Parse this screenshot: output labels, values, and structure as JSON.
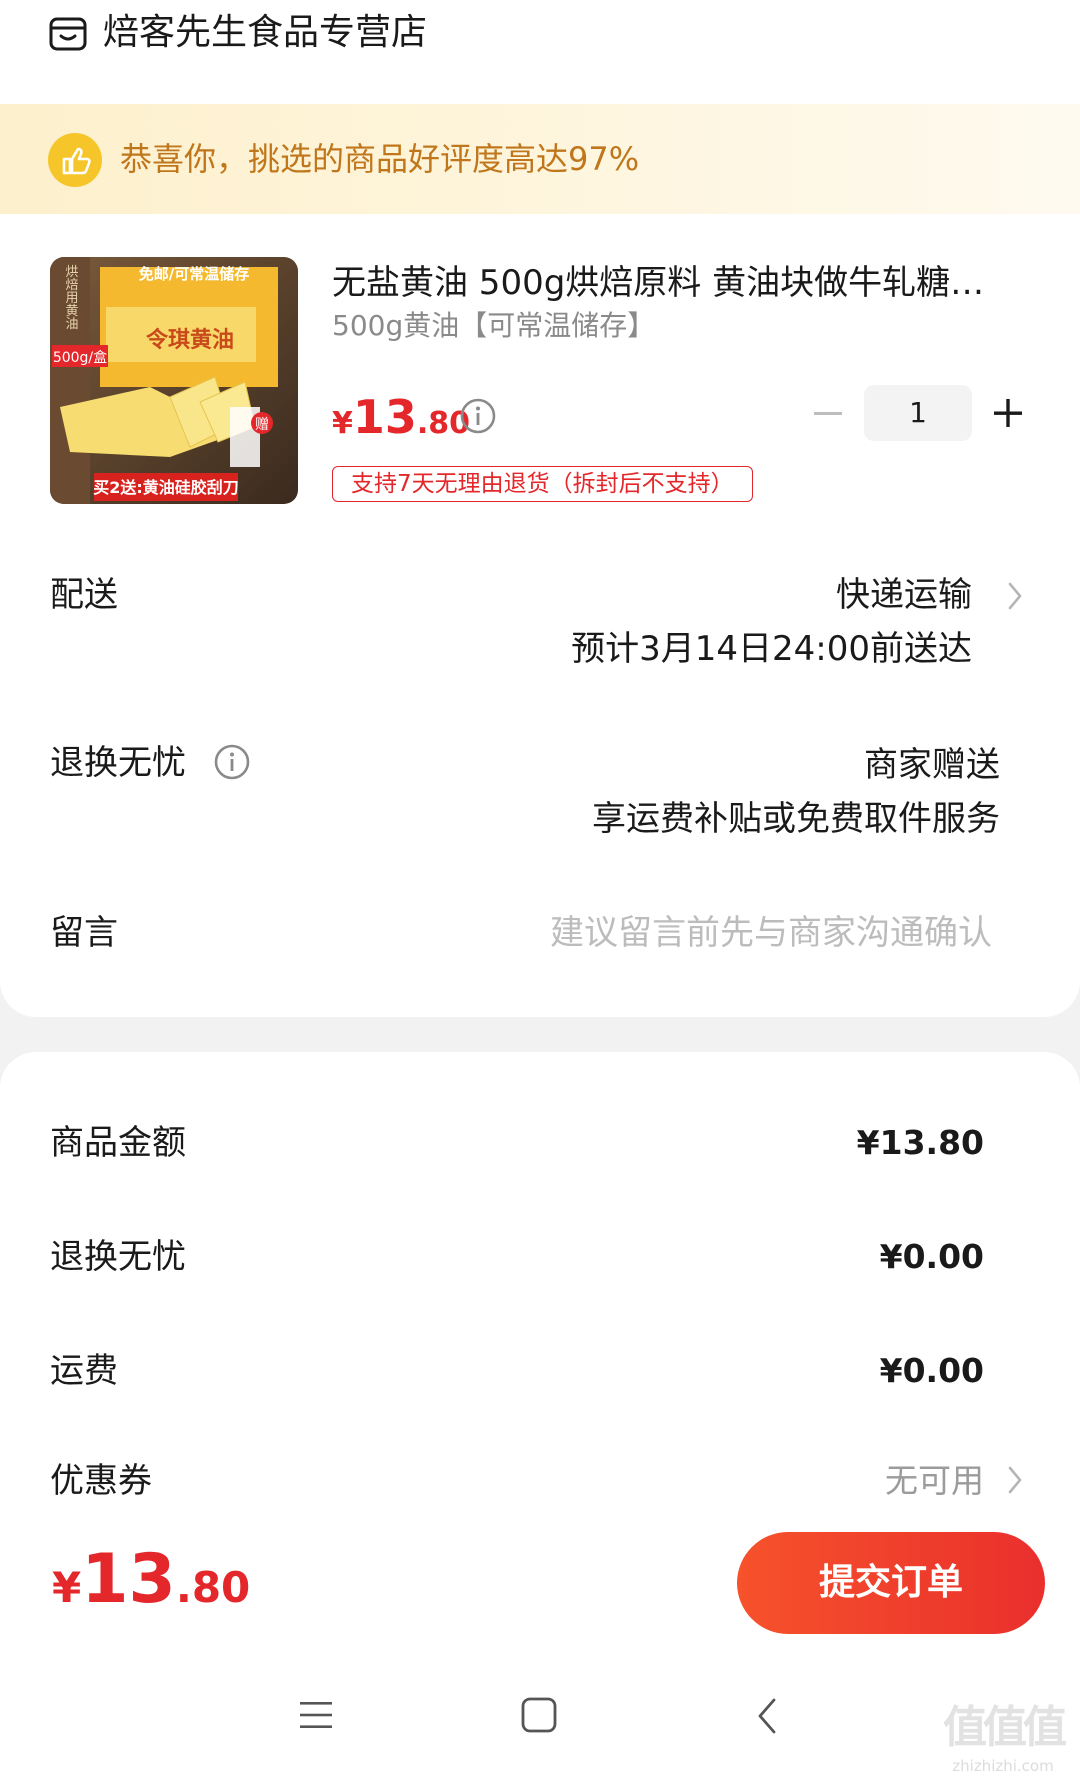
{
  "store": {
    "name": "焙客先生食品专营店",
    "icon": "store-icon"
  },
  "banner": {
    "text": "恭喜你，挑选的商品好评度高达97%",
    "icon": "thumbs-up-icon"
  },
  "product": {
    "title": "无盐黄油 500g烘焙原料 黄油块做牛轧糖…",
    "spec": "500g黄油【可常温储存】",
    "price_yen": "¥",
    "price_int": "13",
    "price_dec": ".80",
    "quantity": "1",
    "return_tag": "支持7天无理由退货（拆封后不支持）",
    "image_text": {
      "tag": "免邮/可常温储存",
      "brand": "令琪黄油",
      "side": "烘焙用黄油",
      "weight": "500g/盒",
      "promo": "买2送:黄油硅胶刮刀",
      "gift": "赠"
    }
  },
  "delivery": {
    "label": "配送",
    "method": "快递运输",
    "eta": "预计3月14日24:00前送达"
  },
  "worry_free": {
    "label": "退换无忧",
    "value1": "商家赠送",
    "value2": "享运费补贴或免费取件服务"
  },
  "message": {
    "label": "留言",
    "placeholder": "建议留言前先与商家沟通确认"
  },
  "fees": {
    "goods_label": "商品金额",
    "goods_value": "¥13.80",
    "worry_label": "退换无忧",
    "worry_value": "¥0.00",
    "shipping_label": "运费",
    "shipping_value": "¥0.00",
    "coupon_label": "优惠券",
    "coupon_value": "无可用"
  },
  "footer": {
    "yen": "¥",
    "int": "13",
    "dec": ".80",
    "submit_label": "提交订单"
  },
  "watermark": {
    "text": "值值值",
    "url_text": "zhizhizhi.com"
  },
  "colors": {
    "accent_red": "#e4272a",
    "banner_text": "#c0771c",
    "banner_icon": "#f6c52a"
  }
}
